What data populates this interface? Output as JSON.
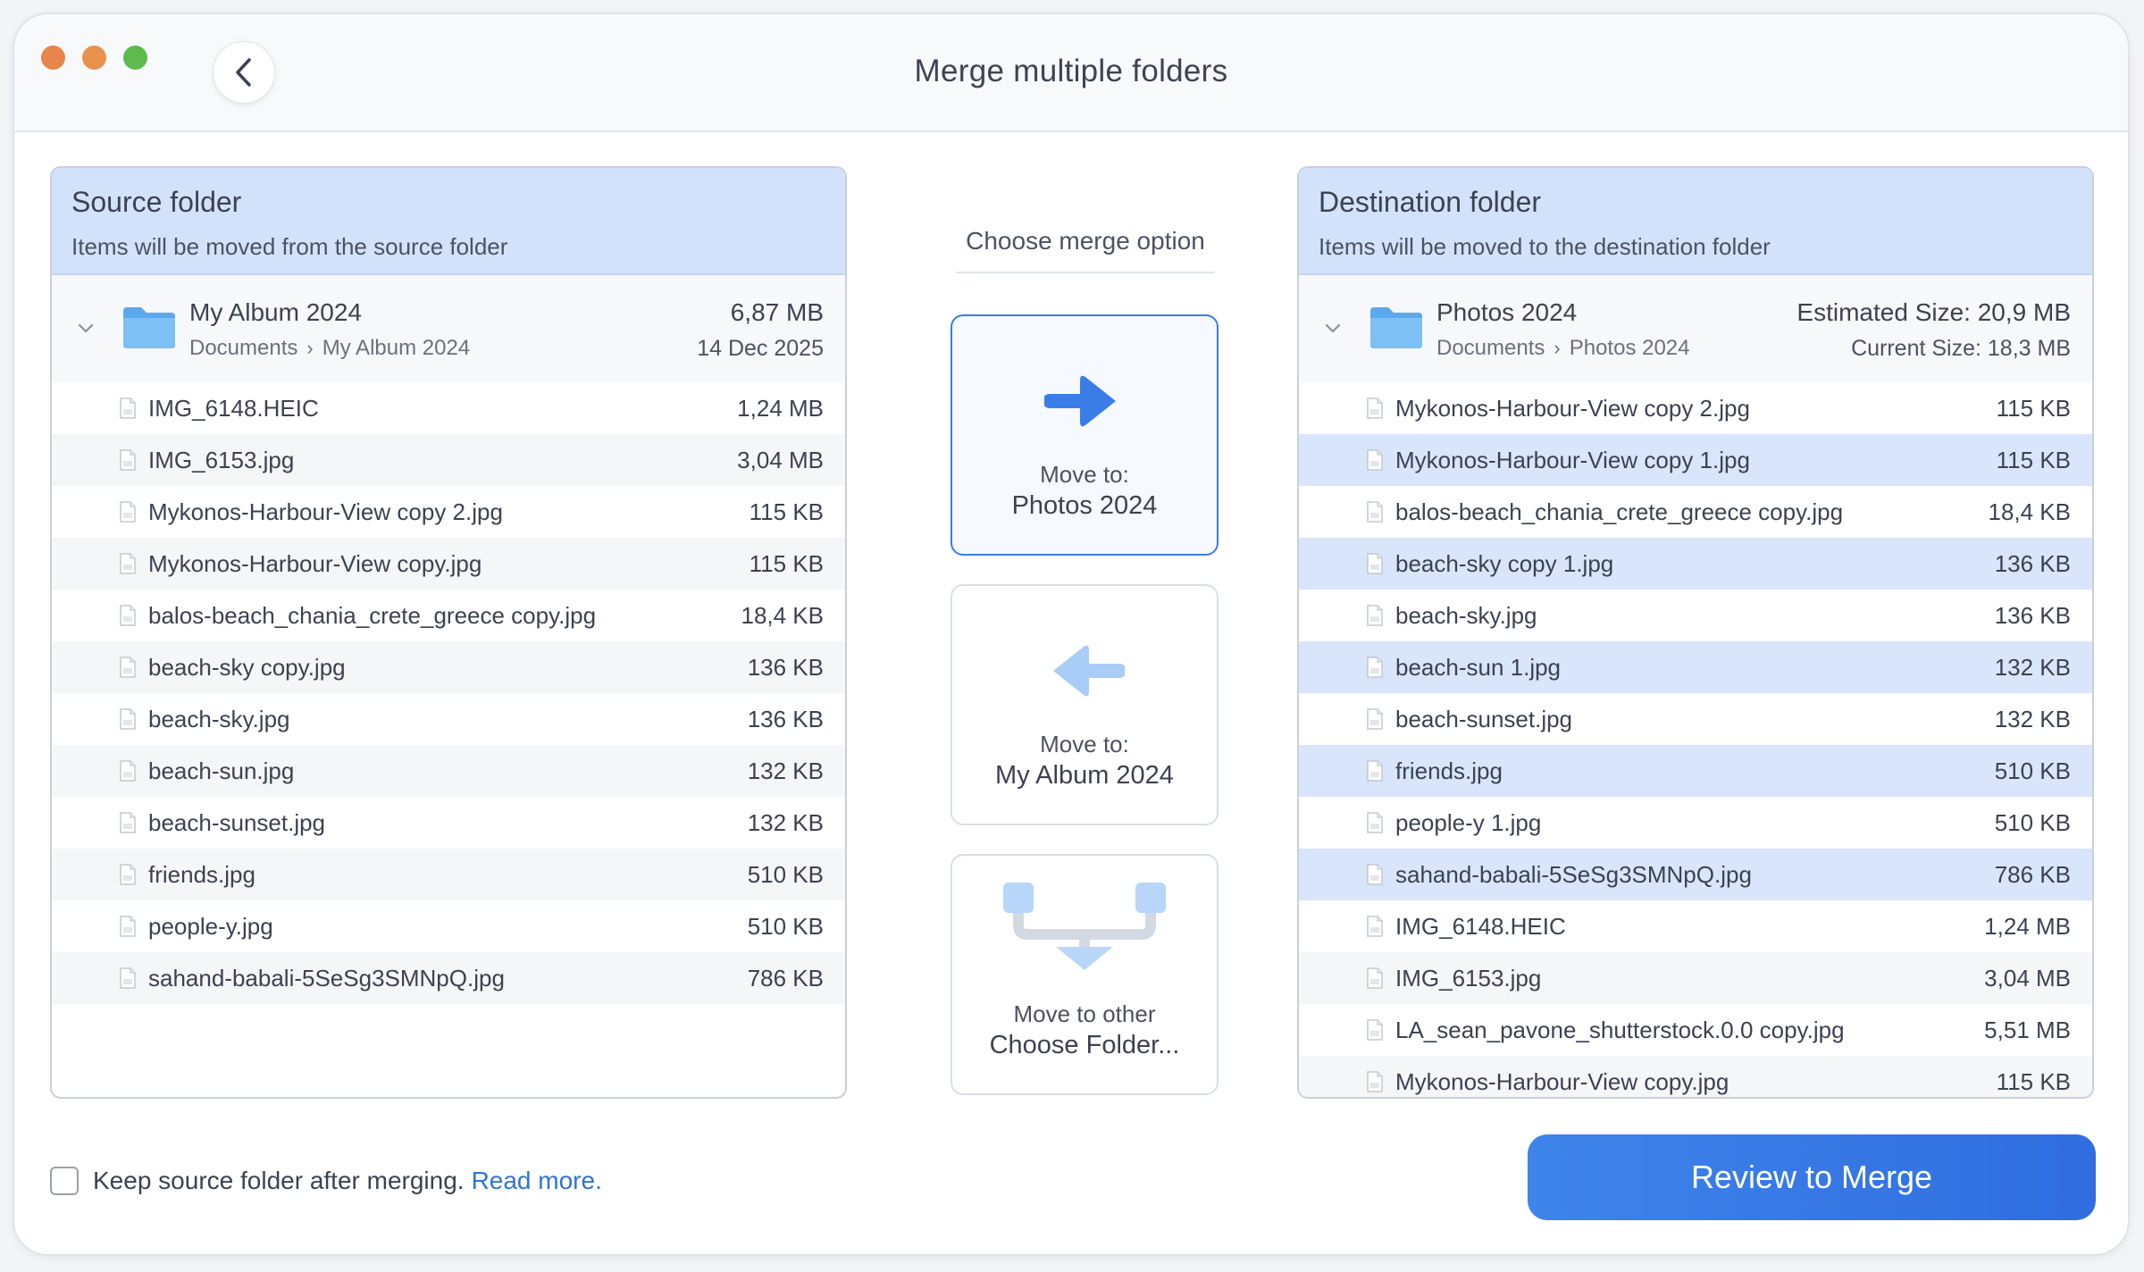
{
  "window": {
    "title": "Merge multiple folders"
  },
  "source": {
    "title": "Source folder",
    "subtitle": "Items will be moved from the source folder",
    "folder": {
      "name": "My Album 2024",
      "crumbs": [
        "Documents",
        "My Album 2024"
      ],
      "size": "6,87 MB",
      "date": "14 Dec 2025"
    },
    "files": [
      {
        "name": "IMG_6148.HEIC",
        "size": "1,24 MB"
      },
      {
        "name": "IMG_6153.jpg",
        "size": "3,04 MB"
      },
      {
        "name": "Mykonos-Harbour-View copy 2.jpg",
        "size": "115 KB"
      },
      {
        "name": "Mykonos-Harbour-View copy.jpg",
        "size": "115 KB"
      },
      {
        "name": "balos-beach_chania_crete_greece copy.jpg",
        "size": "18,4 KB"
      },
      {
        "name": "beach-sky copy.jpg",
        "size": "136 KB"
      },
      {
        "name": "beach-sky.jpg",
        "size": "136 KB"
      },
      {
        "name": "beach-sun.jpg",
        "size": "132 KB"
      },
      {
        "name": "beach-sunset.jpg",
        "size": "132 KB"
      },
      {
        "name": "friends.jpg",
        "size": "510 KB"
      },
      {
        "name": "people-y.jpg",
        "size": "510 KB"
      },
      {
        "name": "sahand-babali-5SeSg3SMNpQ.jpg",
        "size": "786 KB"
      }
    ]
  },
  "merge": {
    "label": "Choose merge option",
    "options": [
      {
        "line1": "Move to:",
        "line2": "Photos 2024",
        "icon": "arrow-right-icon",
        "selected": true
      },
      {
        "line1": "Move to:",
        "line2": "My Album 2024",
        "icon": "arrow-left-icon",
        "selected": false
      },
      {
        "line1": "Move to other",
        "line2": "Choose Folder...",
        "icon": "merge-down-icon",
        "selected": false
      }
    ]
  },
  "dest": {
    "title": "Destination folder",
    "subtitle": "Items will be moved to the destination folder",
    "folder": {
      "name": "Photos 2024",
      "crumbs": [
        "Documents",
        "Photos 2024"
      ],
      "estimated": "Estimated Size: 20,9 MB",
      "current": "Current Size: 18,3 MB"
    },
    "files": [
      {
        "name": "Mykonos-Harbour-View copy 2.jpg",
        "size": "115 KB",
        "new": false
      },
      {
        "name": "Mykonos-Harbour-View copy 1.jpg",
        "size": "115 KB",
        "new": true
      },
      {
        "name": "balos-beach_chania_crete_greece copy.jpg",
        "size": "18,4 KB",
        "new": false
      },
      {
        "name": "beach-sky copy 1.jpg",
        "size": "136 KB",
        "new": true
      },
      {
        "name": "beach-sky.jpg",
        "size": "136 KB",
        "new": false
      },
      {
        "name": "beach-sun 1.jpg",
        "size": "132 KB",
        "new": true
      },
      {
        "name": "beach-sunset.jpg",
        "size": "132 KB",
        "new": false
      },
      {
        "name": "friends.jpg",
        "size": "510 KB",
        "new": true
      },
      {
        "name": "people-y 1.jpg",
        "size": "510 KB",
        "new": false
      },
      {
        "name": "sahand-babali-5SeSg3SMNpQ.jpg",
        "size": "786 KB",
        "new": true
      },
      {
        "name": "IMG_6148.HEIC",
        "size": "1,24 MB",
        "new": false
      },
      {
        "name": "IMG_6153.jpg",
        "size": "3,04 MB",
        "new": false
      },
      {
        "name": "LA_sean_pavone_shutterstock.0.0 copy.jpg",
        "size": "5,51 MB",
        "new": false
      },
      {
        "name": "Mykonos-Harbour-View copy.jpg",
        "size": "115 KB",
        "new": false
      }
    ]
  },
  "footer": {
    "keep_label": "Keep source folder after merging.",
    "read_more": "Read more.",
    "review_button": "Review to Merge"
  },
  "colors": {
    "accent": "#3b7de6",
    "panel_header": "#d3e2fb",
    "selected_row": "#d8e5fb"
  }
}
